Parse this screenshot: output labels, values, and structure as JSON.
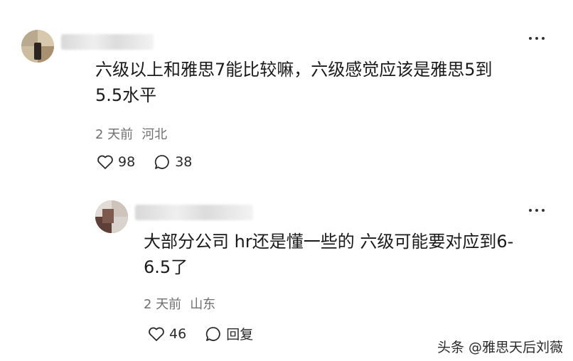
{
  "comments": [
    {
      "text_line1": "六级以上和雅思7能比较嘛，六级感觉应该是雅思5到",
      "text_line2": "5.5水平",
      "meta_time": "2 天前",
      "meta_location": "河北",
      "likes": "98",
      "replies": "38"
    },
    {
      "text_line1": "大部分公司 hr还是懂一些的 六级可能要对应到6-",
      "text_line2": "6.5了",
      "meta_time": "2 天前",
      "meta_location": "山东",
      "likes": "46",
      "reply_label": "回复"
    }
  ],
  "watermark": "头条 @雅思天后刘薇",
  "icons": {
    "more": "more-dots-icon",
    "like": "heart-icon",
    "reply": "comment-bubble-icon"
  },
  "colors": {
    "text": "#1a1a1a",
    "meta": "#6f6f6f",
    "background": "#ffffff"
  }
}
